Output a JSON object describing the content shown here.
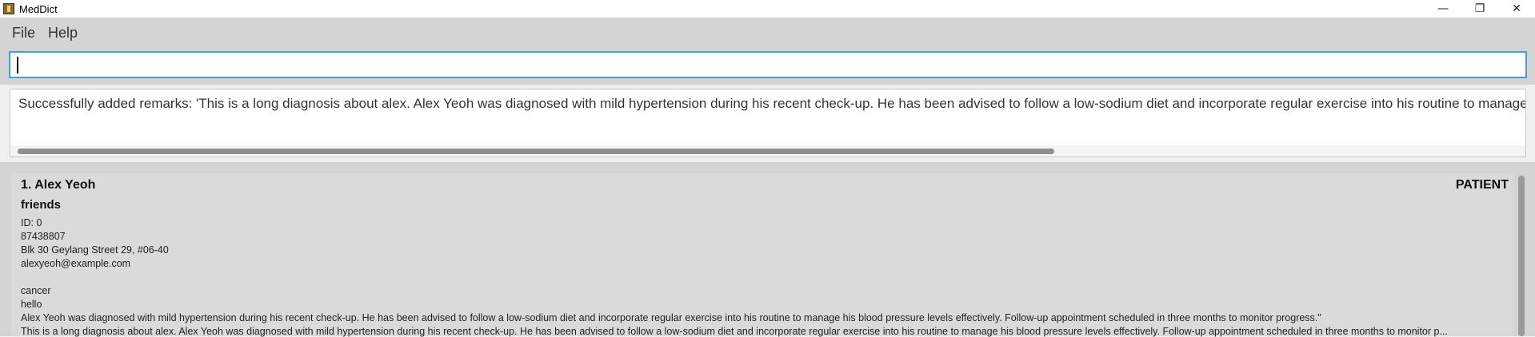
{
  "window": {
    "title": "MedDict",
    "minimize_glyph": "—",
    "maximize_glyph": "❐",
    "close_glyph": "✕"
  },
  "menu": {
    "file": "File",
    "help": "Help"
  },
  "command_box": {
    "value": "",
    "placeholder": ""
  },
  "result": {
    "text": "Successfully added remarks: 'This is a long diagnosis about alex. Alex Yeoh was diagnosed with mild hypertension during his recent check-up. He has been advised to follow a low-sodium diet and incorporate regular exercise into his routine to manage his blood"
  },
  "patients": [
    {
      "index_name": "1. Alex Yeoh",
      "role": "PATIENT",
      "tag": "friends",
      "id": "ID: 0",
      "phone": "87438807",
      "address": "Blk 30 Geylang Street 29, #06-40",
      "email": "alexyeoh@example.com",
      "remark_1": "cancer",
      "remark_2": "hello",
      "remark_3": "Alex Yeoh was diagnosed with mild hypertension during his recent check-up. He has been advised to follow a low-sodium diet and incorporate regular exercise into his routine to manage his blood pressure levels effectively. Follow-up appointment scheduled in three months to monitor progress.\"",
      "remark_4": "This is a long diagnosis about alex. Alex Yeoh was diagnosed with mild hypertension during his recent check-up. He has been advised to follow a low-sodium diet and incorporate regular exercise into his routine to manage his blood pressure levels effectively. Follow-up appointment scheduled in three months to monitor p..."
    }
  ],
  "colors": {
    "input_focus": "#3aa5d8",
    "panel_bg": "#d4d4d4",
    "card_bg": "#dadada"
  }
}
